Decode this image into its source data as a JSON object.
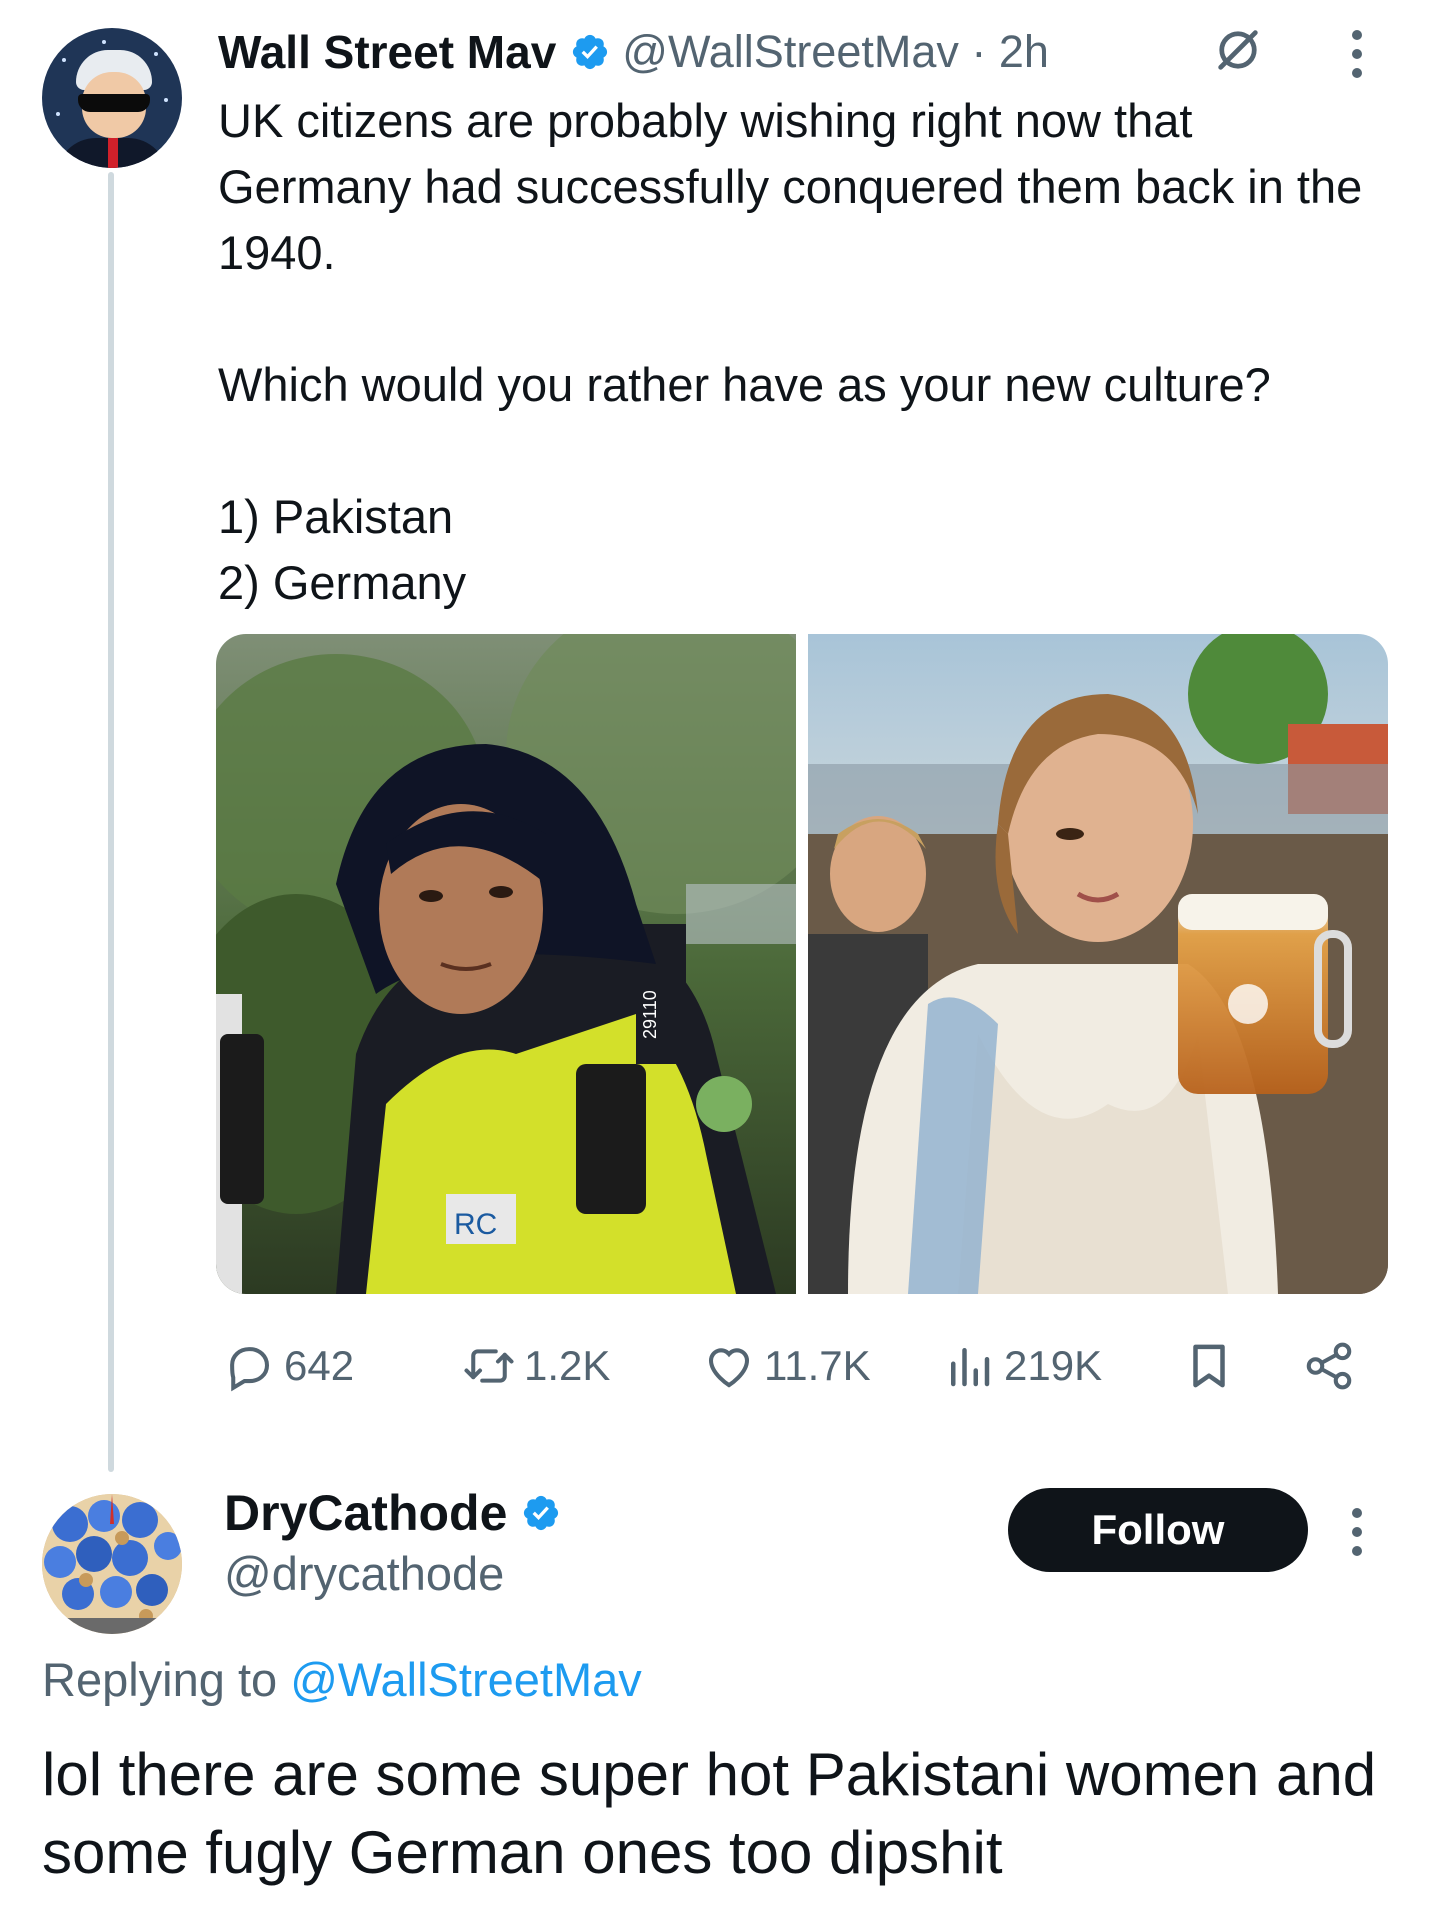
{
  "post": {
    "author_name": "Wall Street Mav",
    "handle": "@WallStreetMav",
    "separator": "·",
    "time": "2h",
    "text": "UK citizens are probably wishing right now that Germany had successfully conquered them back in the 1940.\n\nWhich would you rather have as your new culture?\n\n1) Pakistan\n2) Germany",
    "media": [
      {
        "alt": "police-officer-photo"
      },
      {
        "alt": "oktoberfest-woman-photo"
      }
    ],
    "badge_text": "29110",
    "actions": {
      "replies": "642",
      "reposts": "1.2K",
      "likes": "11.7K",
      "views": "219K"
    }
  },
  "reply": {
    "author_name": "DryCathode",
    "handle": "@drycathode",
    "follow_label": "Follow",
    "replying_prefix": "Replying to ",
    "replying_to": "@WallStreetMav",
    "text": "lol there are some super hot Pakistani women and some fugly German ones too dipshit"
  },
  "colors": {
    "text": "#0f1419",
    "secondary": "#536471",
    "link": "#1d9bf0",
    "verified": "#1d9bf0",
    "thread_line": "#cfd9de"
  }
}
